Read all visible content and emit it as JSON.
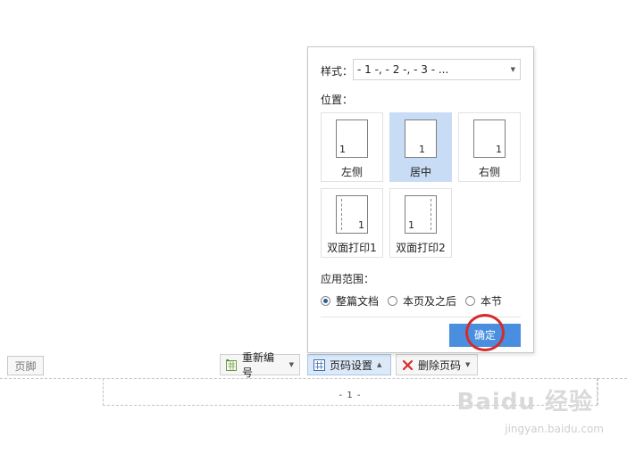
{
  "footer": {
    "tag_label": "页脚",
    "page_number_preview": "- 1 -"
  },
  "toolbar": {
    "renumber_label": "重新编号",
    "page_settings_label": "页码设置",
    "delete_page_number_label": "删除页码"
  },
  "dialog": {
    "style_label": "样式：",
    "style_value": "- 1 -, - 2 -, - 3 - ...",
    "position_label": "位置：",
    "positions": [
      {
        "label": "左侧",
        "number": "1",
        "selected": false
      },
      {
        "label": "居中",
        "number": "1",
        "selected": true
      },
      {
        "label": "右侧",
        "number": "1",
        "selected": false
      },
      {
        "label": "双面打印1",
        "number": "1",
        "selected": false
      },
      {
        "label": "双面打印2",
        "number": "1",
        "selected": false
      }
    ],
    "scope_label": "应用范围：",
    "scope_options": [
      {
        "label": "整篇文档",
        "selected": true
      },
      {
        "label": "本页及之后",
        "selected": false
      },
      {
        "label": "本节",
        "selected": false
      }
    ],
    "ok_label": "确定"
  },
  "watermark": {
    "brand": "Baidu 经验",
    "url": "jingyan.baidu.com"
  },
  "colors": {
    "accent": "#4a8fdf",
    "selected_bg": "#c9dcf5",
    "highlight_ring": "#d62b2b"
  }
}
